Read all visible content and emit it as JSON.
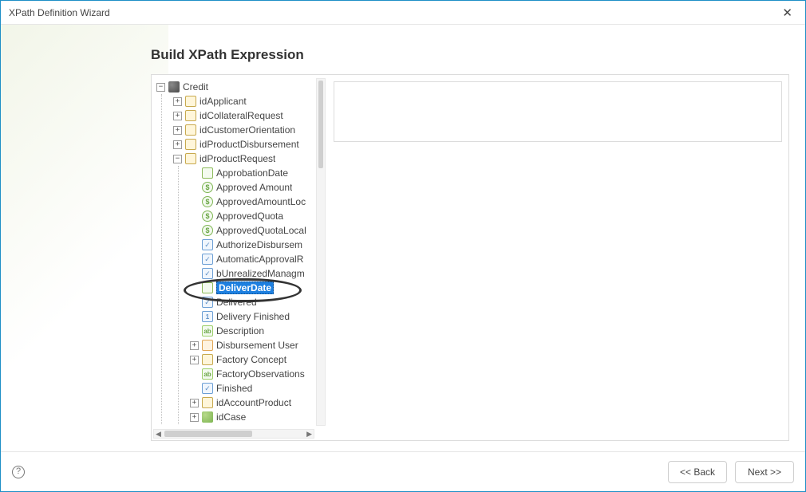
{
  "window": {
    "title": "XPath Definition Wizard"
  },
  "page": {
    "title": "Build XPath Expression"
  },
  "expression": {
    "value": ""
  },
  "footer": {
    "back_label": "<< Back",
    "next_label": "Next >>",
    "help_label": "?"
  },
  "toggles": {
    "plus": "+",
    "minus": "−"
  },
  "tree": {
    "root": {
      "label": "Credit",
      "expanded": true,
      "children": [
        {
          "id": "idApplicant",
          "label": "idApplicant",
          "kind": "folder",
          "toggle": "plus"
        },
        {
          "id": "idCollateralRequest",
          "label": "idCollateralRequest",
          "kind": "folder",
          "toggle": "plus"
        },
        {
          "id": "idCustomerOrientation",
          "label": "idCustomerOrientation",
          "kind": "folder",
          "toggle": "plus"
        },
        {
          "id": "idProductDisbursement",
          "label": "idProductDisbursement",
          "kind": "folder",
          "toggle": "plus"
        },
        {
          "id": "idProductRequest",
          "label": "idProductRequest",
          "kind": "folder",
          "toggle": "minus",
          "children": [
            {
              "label": "ApprobationDate",
              "kind": "date"
            },
            {
              "label": "Approved Amount",
              "kind": "money"
            },
            {
              "label": "ApprovedAmountLoc",
              "kind": "money"
            },
            {
              "label": "ApprovedQuota",
              "kind": "money"
            },
            {
              "label": "ApprovedQuotaLocal",
              "kind": "money"
            },
            {
              "label": "AuthorizeDisbursem",
              "kind": "check"
            },
            {
              "label": "AutomaticApprovalR",
              "kind": "check"
            },
            {
              "label": "bUnrealizedManagm",
              "kind": "check"
            },
            {
              "label": "DeliverDate",
              "kind": "date",
              "selected": true
            },
            {
              "label": "Delivered",
              "kind": "check"
            },
            {
              "label": "Delivery Finished",
              "kind": "num"
            },
            {
              "label": "Description",
              "kind": "text"
            },
            {
              "label": "Disbursement User",
              "kind": "user",
              "toggle": "plus"
            },
            {
              "label": "Factory Concept",
              "kind": "folder",
              "toggle": "plus"
            },
            {
              "label": "FactoryObservations",
              "kind": "text"
            },
            {
              "label": "Finished",
              "kind": "check"
            },
            {
              "label": "idAccountProduct",
              "kind": "folder",
              "toggle": "plus"
            },
            {
              "label": "idCase",
              "kind": "green-cube",
              "toggle": "plus"
            }
          ]
        }
      ]
    }
  },
  "icons": {
    "money_glyph": "$",
    "check_glyph": "✓",
    "num_glyph": "1",
    "text_glyph": "ab"
  }
}
